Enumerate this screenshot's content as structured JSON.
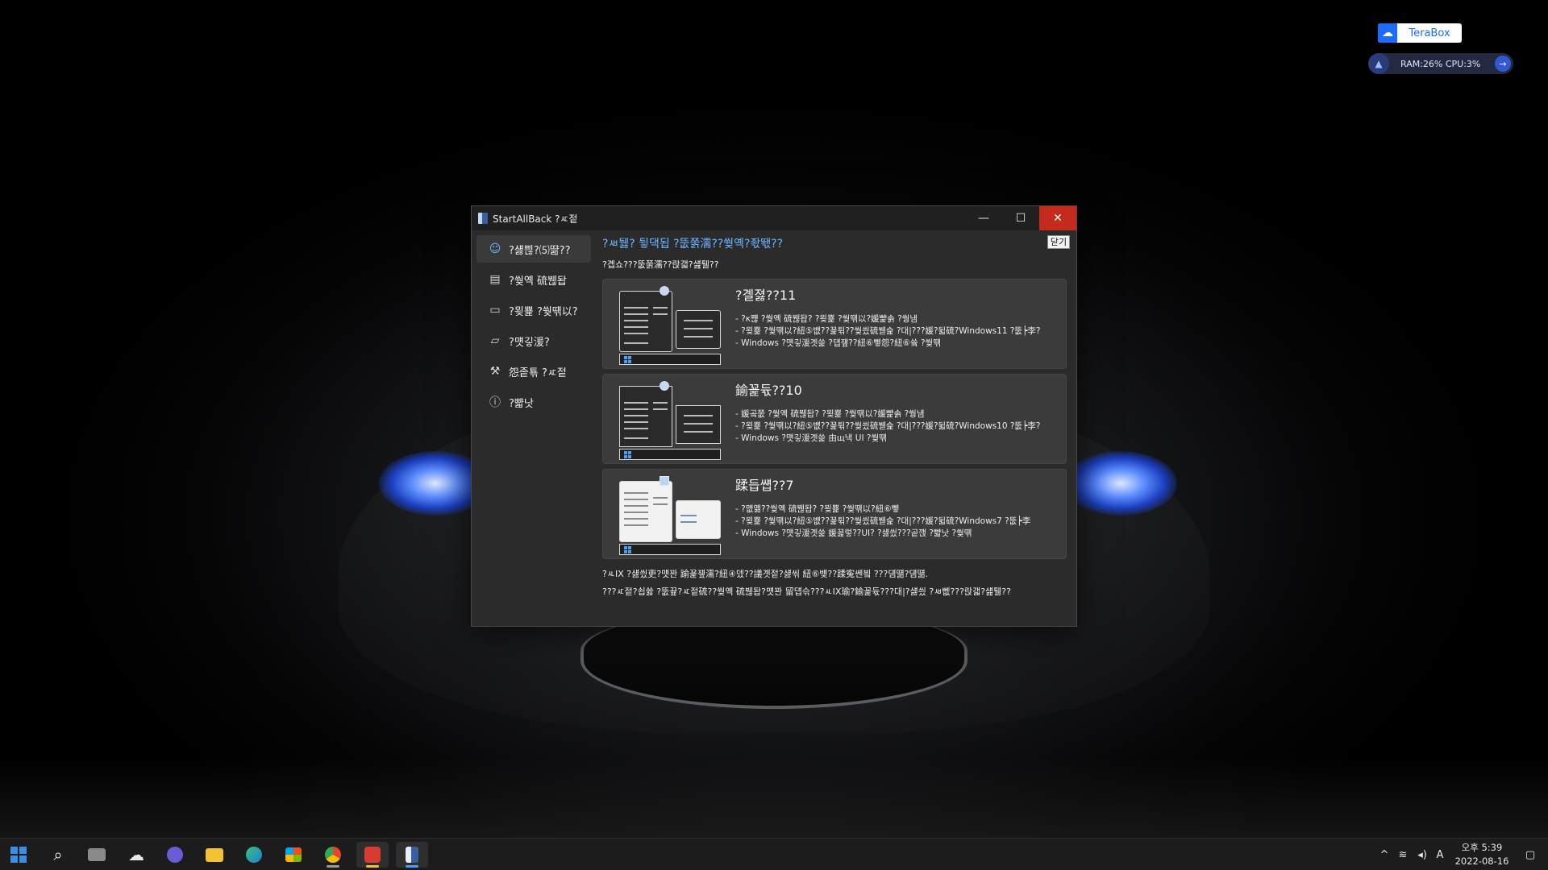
{
  "desktop": {
    "widgets": {
      "terabox_label": "TeraBox",
      "sysmon_text": "RAM:26%  CPU:3%"
    }
  },
  "window": {
    "title": "StartAllBack ?ㅼ젙",
    "close_tooltip": "닫기",
    "sidebar": {
      "items": [
        {
          "label": "?섏쁺?⑸땲??",
          "icon": "smile-icon",
          "active": true
        },
        {
          "label": "?쒖옉 硫붾돱",
          "icon": "start-menu-icon",
          "active": false
        },
        {
          "label": "?묒뾽 ?쒖떆以?",
          "icon": "taskbar-icon",
          "active": false
        },
        {
          "label": "?먯깋湲?",
          "icon": "folder-icon",
          "active": false
        },
        {
          "label": "怨좉툒 ?ㅼ젙",
          "icon": "wrench-icon",
          "active": false
        },
        {
          "label": "?뺣낫",
          "icon": "info-icon",
          "active": false
        }
      ]
    },
    "content": {
      "heading": "?ㅽ뒗? 뒿댁됩 ?뚮쭑濡??쒖옉?좏뙋??",
      "subtitle": "?곕쇼???뚮쭑濡??랁갧?섎퉬??",
      "cards": [
        {
          "title": "?곌졇??11",
          "lines": [
            "- ?κ쨶 ?쒖옉 硫붾돱? ?묒뾽 ?쒖떆以?媛뺥솕 ?쒕냼",
            "- ?묒뾽 ?쒖떆以?紐⑤뱺??꾩튂??쒖씠硫붿슱 ?대|???媛?뒯硫?Windows11 ?뚮┝李?",
            "- Windows ?먯깋湲곗쓽 ?덉쟾??紐⑥뼇怨?紐⑥쓬 ?쒖떆"
          ],
          "variant": "win11"
        },
        {
          "title": "鍮꾩듃??10",
          "lines": [
            "- 媛곸쭚 ?쒖옉 硫붾돱? ?묒뾽 ?쒖떆以?媛뺥솕 ?쒕냼",
            "- ?묒뾽 ?쒖떆以?紐⑤뱺??꾩튂??쒖씠硫붿슱 ?대|???媛?뒯硫?Windows10 ?뚮┝李?",
            "- Windows ?먯깋湲곗쓽 由щ낵 UI ?쒖떆"
          ],
          "variant": "win10"
        },
        {
          "title": "蹂듭썝??7",
          "lines": [
            "- ?먮옒??쒖옉 硫붾돱? ?묒뾽 ?쒖떆以?紐⑥뼇",
            "- ?묒뾽 ?쒖떆以?紐⑤뱺??꾩튂??쒖씠硫붿슱 ?대|???媛?뒯硫?Windows7 ?뚮┝李",
            "- Windows ?먯깋湲곗쓽 媛꾧렇??UI? ?섏씠???곹깭 ?뺣낫 ?쒖떆"
          ],
          "variant": "win7"
        }
      ],
      "footnote_1": "?ㅻIX ?섏씠吏?먯꽌 踰꾩쟾濡?紐④뎄??議곗젙?섏씪 紐⑥뱾??蹂寃쏀빀 ???덈떎?덈떎.",
      "footnote_2": "???ㅼ젙?쇱쓣 ?뚮끂?ㅼ젙硫??쒖옉 硫붾돱?먯꽌 留덉슦???ㅻIX瑜?鍮꾩듃???대|?섏씠 ?ㅽ뻾???랁갧?섎퉬??"
    }
  },
  "taskbar": {
    "apps": [
      {
        "name": "start-button",
        "icon": "windows-logo-icon"
      },
      {
        "name": "search-button",
        "icon": "search-icon"
      },
      {
        "name": "task-view-button",
        "icon": "task-view-icon"
      },
      {
        "name": "weather-widget-button",
        "icon": "weather-icon"
      },
      {
        "name": "chat-button",
        "icon": "chat-icon"
      },
      {
        "name": "file-explorer-button",
        "icon": "folder-icon"
      },
      {
        "name": "edge-button",
        "icon": "edge-icon"
      },
      {
        "name": "store-button",
        "icon": "store-icon"
      },
      {
        "name": "chrome-button",
        "icon": "chrome-icon"
      },
      {
        "name": "app-red-button",
        "icon": "red-app-icon"
      },
      {
        "name": "startallback-button",
        "icon": "startallback-icon"
      }
    ],
    "tray": {
      "ime_label": "A",
      "time": "오후 5:39",
      "date": "2022-08-16"
    }
  },
  "colors": {
    "accent": "#6cb4ff",
    "close_red": "#c42b1c",
    "window_bg": "#2b2b2b",
    "card_bg": "#3b3b3b"
  }
}
